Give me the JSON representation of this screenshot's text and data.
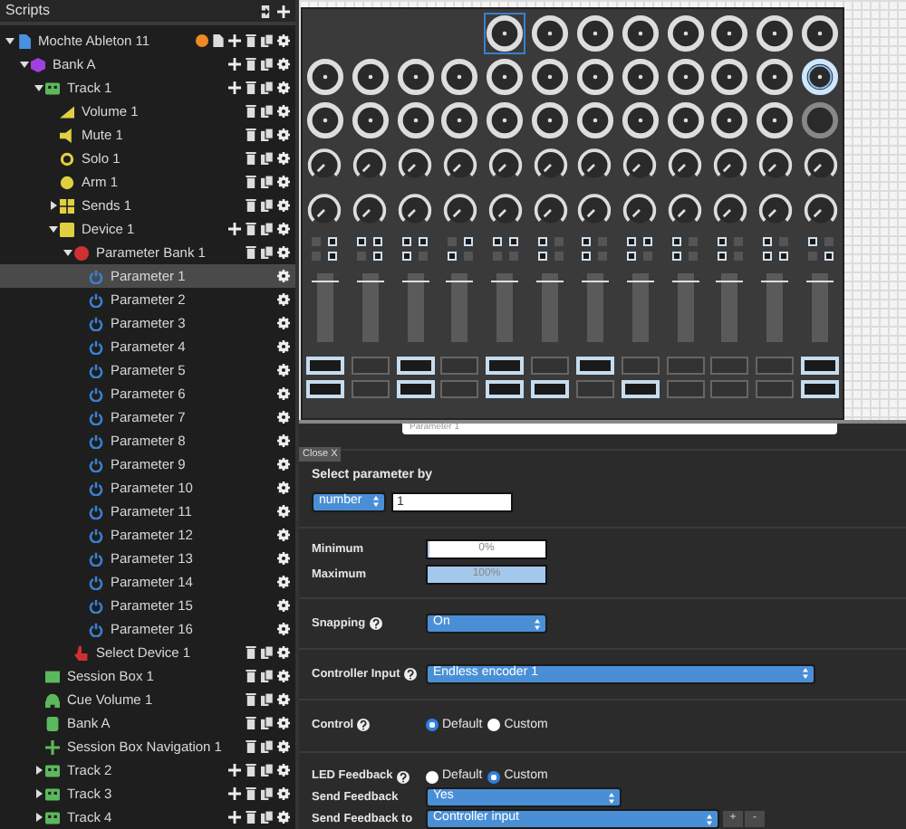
{
  "sidebar": {
    "title": "Scripts",
    "header_actions": [
      {
        "kind": "import"
      },
      {
        "kind": "add"
      }
    ],
    "tree": [
      {
        "label": "Mochte Ableton 11",
        "kind": "document",
        "expanded": true,
        "selected": false,
        "actions": [
          {
            "kind": "status"
          },
          {
            "kind": "export"
          },
          {
            "kind": "add"
          },
          {
            "kind": "delete"
          },
          {
            "kind": "duplicate"
          },
          {
            "kind": "settings"
          }
        ],
        "children": [
          {
            "label": "Bank A",
            "kind": "bank",
            "expanded": true,
            "selected": false,
            "actions": [
              {
                "kind": "add"
              },
              {
                "kind": "delete"
              },
              {
                "kind": "duplicate"
              },
              {
                "kind": "settings"
              }
            ],
            "children": [
              {
                "label": "Track 1",
                "kind": "track",
                "expanded": true,
                "selected": false,
                "actions": [
                  {
                    "kind": "add"
                  },
                  {
                    "kind": "delete"
                  },
                  {
                    "kind": "duplicate"
                  },
                  {
                    "kind": "settings"
                  }
                ],
                "children": [
                  {
                    "label": "Volume 1",
                    "kind": "volume",
                    "selected": false,
                    "actions": [
                      {
                        "kind": "delete"
                      },
                      {
                        "kind": "duplicate"
                      },
                      {
                        "kind": "settings"
                      }
                    ]
                  },
                  {
                    "label": "Mute 1",
                    "kind": "mute",
                    "selected": false,
                    "actions": [
                      {
                        "kind": "delete"
                      },
                      {
                        "kind": "duplicate"
                      },
                      {
                        "kind": "settings"
                      }
                    ]
                  },
                  {
                    "label": "Solo 1",
                    "kind": "solo",
                    "selected": false,
                    "actions": [
                      {
                        "kind": "delete"
                      },
                      {
                        "kind": "duplicate"
                      },
                      {
                        "kind": "settings"
                      }
                    ]
                  },
                  {
                    "label": "Arm 1",
                    "kind": "arm",
                    "selected": false,
                    "actions": [
                      {
                        "kind": "delete"
                      },
                      {
                        "kind": "duplicate"
                      },
                      {
                        "kind": "settings"
                      }
                    ]
                  },
                  {
                    "label": "Sends 1",
                    "kind": "sends",
                    "expanded": false,
                    "selected": false,
                    "actions": [
                      {
                        "kind": "delete"
                      },
                      {
                        "kind": "duplicate"
                      },
                      {
                        "kind": "settings"
                      }
                    ]
                  },
                  {
                    "label": "Device 1",
                    "kind": "device",
                    "expanded": true,
                    "selected": false,
                    "actions": [
                      {
                        "kind": "add"
                      },
                      {
                        "kind": "delete"
                      },
                      {
                        "kind": "duplicate"
                      },
                      {
                        "kind": "settings"
                      }
                    ],
                    "children": [
                      {
                        "label": "Parameter Bank 1",
                        "kind": "parambank",
                        "expanded": true,
                        "selected": false,
                        "actions": [
                          {
                            "kind": "delete"
                          },
                          {
                            "kind": "duplicate"
                          },
                          {
                            "kind": "settings"
                          }
                        ],
                        "children": [
                          {
                            "label": "Parameter 1",
                            "kind": "parameter",
                            "selected": true,
                            "actions": [
                              {
                                "kind": "settings"
                              }
                            ]
                          },
                          {
                            "label": "Parameter 2",
                            "kind": "parameter",
                            "selected": false,
                            "actions": [
                              {
                                "kind": "settings"
                              }
                            ]
                          },
                          {
                            "label": "Parameter 3",
                            "kind": "parameter",
                            "selected": false,
                            "actions": [
                              {
                                "kind": "settings"
                              }
                            ]
                          },
                          {
                            "label": "Parameter 4",
                            "kind": "parameter",
                            "selected": false,
                            "actions": [
                              {
                                "kind": "settings"
                              }
                            ]
                          },
                          {
                            "label": "Parameter 5",
                            "kind": "parameter",
                            "selected": false,
                            "actions": [
                              {
                                "kind": "settings"
                              }
                            ]
                          },
                          {
                            "label": "Parameter 6",
                            "kind": "parameter",
                            "selected": false,
                            "actions": [
                              {
                                "kind": "settings"
                              }
                            ]
                          },
                          {
                            "label": "Parameter 7",
                            "kind": "parameter",
                            "selected": false,
                            "actions": [
                              {
                                "kind": "settings"
                              }
                            ]
                          },
                          {
                            "label": "Parameter 8",
                            "kind": "parameter",
                            "selected": false,
                            "actions": [
                              {
                                "kind": "settings"
                              }
                            ]
                          },
                          {
                            "label": "Parameter 9",
                            "kind": "parameter",
                            "selected": false,
                            "actions": [
                              {
                                "kind": "settings"
                              }
                            ]
                          },
                          {
                            "label": "Parameter 10",
                            "kind": "parameter",
                            "selected": false,
                            "actions": [
                              {
                                "kind": "settings"
                              }
                            ]
                          },
                          {
                            "label": "Parameter 11",
                            "kind": "parameter",
                            "selected": false,
                            "actions": [
                              {
                                "kind": "settings"
                              }
                            ]
                          },
                          {
                            "label": "Parameter 12",
                            "kind": "parameter",
                            "selected": false,
                            "actions": [
                              {
                                "kind": "settings"
                              }
                            ]
                          },
                          {
                            "label": "Parameter 13",
                            "kind": "parameter",
                            "selected": false,
                            "actions": [
                              {
                                "kind": "settings"
                              }
                            ]
                          },
                          {
                            "label": "Parameter 14",
                            "kind": "parameter",
                            "selected": false,
                            "actions": [
                              {
                                "kind": "settings"
                              }
                            ]
                          },
                          {
                            "label": "Parameter 15",
                            "kind": "parameter",
                            "selected": false,
                            "actions": [
                              {
                                "kind": "settings"
                              }
                            ]
                          },
                          {
                            "label": "Parameter 16",
                            "kind": "parameter",
                            "selected": false,
                            "actions": [
                              {
                                "kind": "settings"
                              }
                            ]
                          }
                        ]
                      },
                      {
                        "label": "Select Device 1",
                        "kind": "select",
                        "selected": false,
                        "actions": [
                          {
                            "kind": "delete"
                          },
                          {
                            "kind": "duplicate"
                          },
                          {
                            "kind": "settings"
                          }
                        ]
                      }
                    ]
                  }
                ]
              },
              {
                "label": "Session Box 1",
                "kind": "session",
                "selected": false,
                "actions": [
                  {
                    "kind": "delete"
                  },
                  {
                    "kind": "duplicate"
                  },
                  {
                    "kind": "settings"
                  }
                ]
              },
              {
                "label": "Cue Volume 1",
                "kind": "cue",
                "selected": false,
                "actions": [
                  {
                    "kind": "delete"
                  },
                  {
                    "kind": "duplicate"
                  },
                  {
                    "kind": "settings"
                  }
                ]
              },
              {
                "label": "Bank A",
                "kind": "bankref",
                "selected": false,
                "actions": [
                  {
                    "kind": "delete"
                  },
                  {
                    "kind": "duplicate"
                  },
                  {
                    "kind": "settings"
                  }
                ]
              },
              {
                "label": "Session Box Navigation 1",
                "kind": "navigation",
                "selected": false,
                "actions": [
                  {
                    "kind": "delete"
                  },
                  {
                    "kind": "duplicate"
                  },
                  {
                    "kind": "settings"
                  }
                ]
              },
              {
                "label": "Track 2",
                "kind": "track",
                "expanded": false,
                "selected": false,
                "actions": [
                  {
                    "kind": "add"
                  },
                  {
                    "kind": "delete"
                  },
                  {
                    "kind": "duplicate"
                  },
                  {
                    "kind": "settings"
                  }
                ]
              },
              {
                "label": "Track 3",
                "kind": "track",
                "expanded": false,
                "selected": false,
                "actions": [
                  {
                    "kind": "add"
                  },
                  {
                    "kind": "delete"
                  },
                  {
                    "kind": "duplicate"
                  },
                  {
                    "kind": "settings"
                  }
                ]
              },
              {
                "label": "Track 4",
                "kind": "track",
                "expanded": false,
                "selected": false,
                "actions": [
                  {
                    "kind": "add"
                  },
                  {
                    "kind": "delete"
                  },
                  {
                    "kind": "duplicate"
                  },
                  {
                    "kind": "settings"
                  }
                ]
              }
            ]
          }
        ]
      }
    ]
  },
  "controller": {
    "ring_rows": [
      [
        {
          "kind": "selected"
        },
        {
          "kind": "normal"
        },
        {
          "kind": "normal"
        },
        {
          "kind": "normal"
        },
        {
          "kind": "normal"
        },
        {
          "kind": "normal"
        },
        {
          "kind": "normal"
        },
        {
          "kind": "normal"
        }
      ],
      [
        {
          "kind": "normal"
        },
        {
          "kind": "normal"
        },
        {
          "kind": "normal"
        },
        {
          "kind": "normal"
        },
        {
          "kind": "normal"
        },
        {
          "kind": "normal"
        },
        {
          "kind": "normal"
        },
        {
          "kind": "normal"
        },
        {
          "kind": "normal"
        },
        {
          "kind": "normal"
        },
        {
          "kind": "normal"
        },
        {
          "kind": "hover"
        }
      ],
      [
        {
          "kind": "normal"
        },
        {
          "kind": "normal"
        },
        {
          "kind": "normal"
        },
        {
          "kind": "normal"
        },
        {
          "kind": "normal"
        },
        {
          "kind": "normal"
        },
        {
          "kind": "normal"
        },
        {
          "kind": "normal"
        },
        {
          "kind": "normal"
        },
        {
          "kind": "normal"
        },
        {
          "kind": "normal"
        },
        {
          "kind": "off"
        }
      ]
    ],
    "button_rows": [
      [
        false,
        true,
        true,
        true,
        true,
        true,
        false,
        true,
        true,
        true,
        true,
        false,
        true,
        false,
        true,
        true,
        true,
        false,
        true,
        false,
        true,
        false,
        true,
        false
      ],
      [
        false,
        true,
        false,
        true,
        true,
        false,
        true,
        false,
        false,
        false,
        true,
        false,
        true,
        false,
        true,
        false,
        true,
        false,
        true,
        false,
        true,
        true,
        false,
        true
      ]
    ],
    "faders": [
      {
        "level": 0.9
      },
      {
        "level": 0.9
      },
      {
        "level": 0.9
      },
      {
        "level": 0.9
      },
      {
        "level": 0.9
      },
      {
        "level": 0.9
      },
      {
        "level": 0.9
      },
      {
        "level": 0.9
      },
      {
        "level": 0.9
      },
      {
        "level": 0.9
      },
      {
        "level": 0.9
      },
      {
        "level": 0.9
      }
    ],
    "pad_rows": [
      [
        true,
        false,
        true,
        false,
        true,
        false,
        true,
        false,
        false,
        false,
        false,
        true
      ],
      [
        true,
        false,
        true,
        false,
        true,
        true,
        false,
        true,
        false,
        false,
        false,
        true
      ]
    ]
  },
  "editor": {
    "close_label": "Close X",
    "name_value": "Parameter 1",
    "select_by": {
      "label": "Select parameter by",
      "mode": "number",
      "value": "1"
    },
    "minimum": {
      "label": "Minimum",
      "reading": "0%",
      "level": 0.02
    },
    "maximum": {
      "label": "Maximum",
      "reading": "100%",
      "level": 1
    },
    "snapping": {
      "label": "Snapping",
      "value": "On"
    },
    "controller_input": {
      "label": "Controller Input",
      "value": "Endless encoder 1"
    },
    "control": {
      "label": "Control",
      "options": [
        {
          "label": "Default",
          "selected": true
        },
        {
          "label": "Custom",
          "selected": false
        }
      ]
    },
    "led_feedback": {
      "label": "LED Feedback",
      "options": [
        {
          "label": "Default",
          "selected": false
        },
        {
          "label": "Custom",
          "selected": true
        }
      ]
    },
    "send_feedback": {
      "label": "Send Feedback",
      "value": "Yes"
    },
    "send_feedback_to": {
      "label": "Send Feedback to",
      "value": "Controller input",
      "buttons": [
        "+",
        "-"
      ]
    }
  }
}
